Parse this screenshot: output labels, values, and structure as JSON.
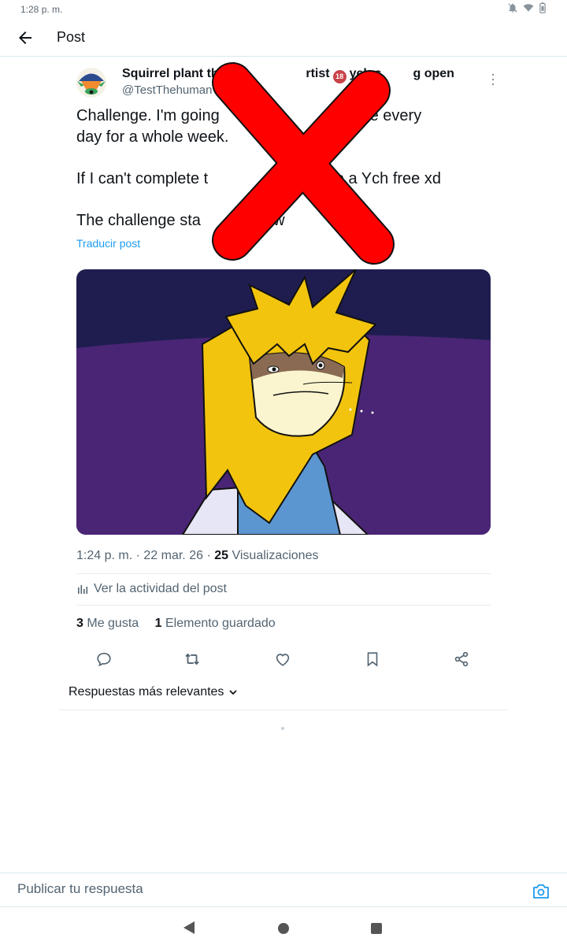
{
  "status_bar": {
    "time": "1:28 p. m.",
    "icons": [
      "notifications-off-icon",
      "wifi-icon",
      "battery-icon"
    ]
  },
  "top_bar": {
    "back_icon": "arrow-left-icon",
    "title": "Post"
  },
  "post": {
    "author": {
      "name_part1": "Squirrel plant the f",
      "name_part2": "rtist",
      "badge": "18",
      "name_part3": "ych s",
      "name_part4": "g open",
      "handle": "@TestThehuman"
    },
    "text": {
      "line1_a": "Challenge. I'm going",
      "line1_b": "picture every",
      "line2": "day for a whole week.",
      "line3_a": "If I can't complete t",
      "line3_b": "ll do a Ych free xd",
      "line4_a": "The challenge sta",
      "line4_b": "morrow"
    },
    "translate_label": "Traducir post",
    "overlay": "red-x-censor-mark",
    "meta": {
      "time": "1:24 p. m.",
      "separator": "·",
      "date": "22 mar. 26",
      "views_count": "25",
      "views_label": "Visualizaciones"
    },
    "activity_label": "Ver la actividad del post",
    "stats": {
      "likes_count": "3",
      "likes_label": "Me gusta",
      "bookmarks_count": "1",
      "bookmarks_label": "Elemento guardado"
    },
    "actions": [
      "reply-icon",
      "retweet-icon",
      "like-icon",
      "bookmark-icon",
      "share-icon"
    ]
  },
  "replies": {
    "sort_label": "Respuestas más relevantes"
  },
  "reply_bar": {
    "placeholder": "Publicar tu respuesta"
  },
  "colors": {
    "accent": "#1d9bf0",
    "text_secondary": "#536471",
    "censor_red": "#ff0000"
  }
}
